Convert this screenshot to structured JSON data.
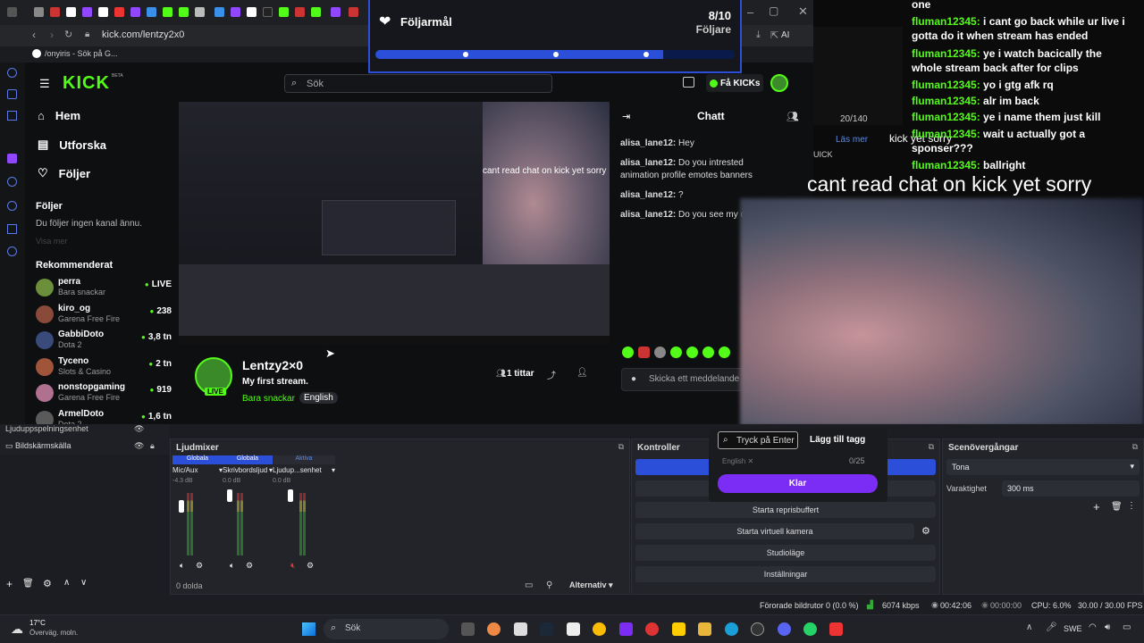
{
  "browser": {
    "url": "kick.com/lentzy2x0",
    "bookmark": "/onyiris - Sök på G...",
    "ai_label": "AI"
  },
  "notification": {
    "title": "Följarmål",
    "count": "8/10",
    "subtitle": "Följare",
    "progress": 0.8
  },
  "kick": {
    "logo": "KICK",
    "logo_badge": "BETA",
    "search_placeholder": "Sök",
    "get_kicks": "Få KICKs",
    "nav": [
      {
        "label": "Hem",
        "icon": "home-icon"
      },
      {
        "label": "Utforska",
        "icon": "browse-icon"
      },
      {
        "label": "Följer",
        "icon": "heart-icon"
      }
    ],
    "follow_heading": "Följer",
    "follow_empty": "Du följer ingen kanal ännu.",
    "follow_extra": "Visa mer",
    "recommended_heading": "Rekommenderat",
    "recommended": [
      {
        "name": "perra",
        "category": "Bara snackar",
        "viewers": "LIVE",
        "color": "#6b8f3a"
      },
      {
        "name": "kiro_og",
        "category": "Garena Free Fire",
        "viewers": "238",
        "color": "#8a4a3a"
      },
      {
        "name": "GabbiDoto",
        "category": "Dota 2",
        "viewers": "3,8 tn",
        "color": "#3a4a7a"
      },
      {
        "name": "Tyceno",
        "category": "Slots & Casino",
        "viewers": "2 tn",
        "color": "#a0543a"
      },
      {
        "name": "nonstopgaming",
        "category": "Garena Free Fire",
        "viewers": "919",
        "color": "#b07090"
      },
      {
        "name": "ArmelDoto",
        "category": "Dota 2",
        "viewers": "1,6 tn",
        "color": "#5a5a5a"
      }
    ],
    "stream": {
      "channel": "Lentzy2×0",
      "title": "My first stream.",
      "category": "Bara snackar",
      "language": "English",
      "viewers": "1 tittar",
      "live": "LIVE",
      "overlay_text": "cant read chat on kick yet sorry"
    },
    "chat": {
      "heading": "Chatt",
      "messages": [
        {
          "user": "alisa_lane12:",
          "text": "Hey"
        },
        {
          "user": "alisa_lane12:",
          "text": "Do you intrested animation profile emotes banners"
        },
        {
          "user": "alisa_lane12:",
          "text": "?"
        },
        {
          "user": "alisa_lane12:",
          "text": "Do you see my c"
        }
      ],
      "input_placeholder": "Skicka ett meddelande"
    }
  },
  "overlay": {
    "lines": [
      {
        "user": "",
        "text": "one"
      },
      {
        "user": "fluman12345:",
        "text": "i cant go back while ur live i gotta do it when stream has ended"
      },
      {
        "user": "fluman12345:",
        "text": "ye i watch bacically the whole stream back after for clips"
      },
      {
        "user": "fluman12345:",
        "text": "yo i gtg afk rq"
      },
      {
        "user": "fluman12345:",
        "text": "alr im back"
      },
      {
        "user": "fluman12345:",
        "text": "ye i name them just kill"
      },
      {
        "user": "fluman12345:",
        "text": "wait u actually got a sponser???"
      },
      {
        "user": "fluman12345:",
        "text": "ballright"
      }
    ],
    "counter": "20/140",
    "more": "Läs mer",
    "kick_yet": "kick yet sorry",
    "big_text": "cant read chat on kick yet sorry",
    "uick": "UICK"
  },
  "tag_popup": {
    "input_placeholder": "Tryck på Enter",
    "add_button": "Lägg till tagg",
    "tag": "English",
    "counter": "0/25",
    "done_button": "Klar"
  },
  "obs": {
    "sources": [
      "Ljuduppspelningsenhet",
      "Bildskärmskälla"
    ],
    "mixer_title": "Ljudmixer",
    "mixer_headers": [
      "Globala",
      "Globala",
      "Aktiva"
    ],
    "channels": [
      {
        "name": "Mic/Aux",
        "db": "-4.3 dB"
      },
      {
        "name": "Skrivbordsljud",
        "db": "0.0 dB"
      },
      {
        "name": "Ljudup...senhet",
        "db": "0.0 dB"
      }
    ],
    "mixer_footer": "0 dolda",
    "alternativ": "Alternativ",
    "controls_title": "Kontroller",
    "controls": [
      "Starta reprisbuffert",
      "Starta virtuell kamera",
      "Studioläge",
      "Inställningar"
    ],
    "transitions_title": "Scenövergångar",
    "transition": "Tona",
    "duration_label": "Varaktighet",
    "duration": "300 ms",
    "status": {
      "dropped": "Förorade bildrutor 0 (0.0 %)",
      "bitrate": "6074 kbps",
      "stream_time": "00:42:06",
      "rec_time": "00:00:00",
      "cpu": "CPU: 6.0%",
      "fps": "30.00 / 30.00 FPS"
    }
  },
  "taskbar": {
    "weather_temp": "17°C",
    "weather_desc": "Överväg. moln.",
    "search": "Sök",
    "lang": "SWE"
  },
  "colors": {
    "kick_green": "#53fc18",
    "purple": "#7b2cf5",
    "obs_blue": "#2b4fd8"
  }
}
